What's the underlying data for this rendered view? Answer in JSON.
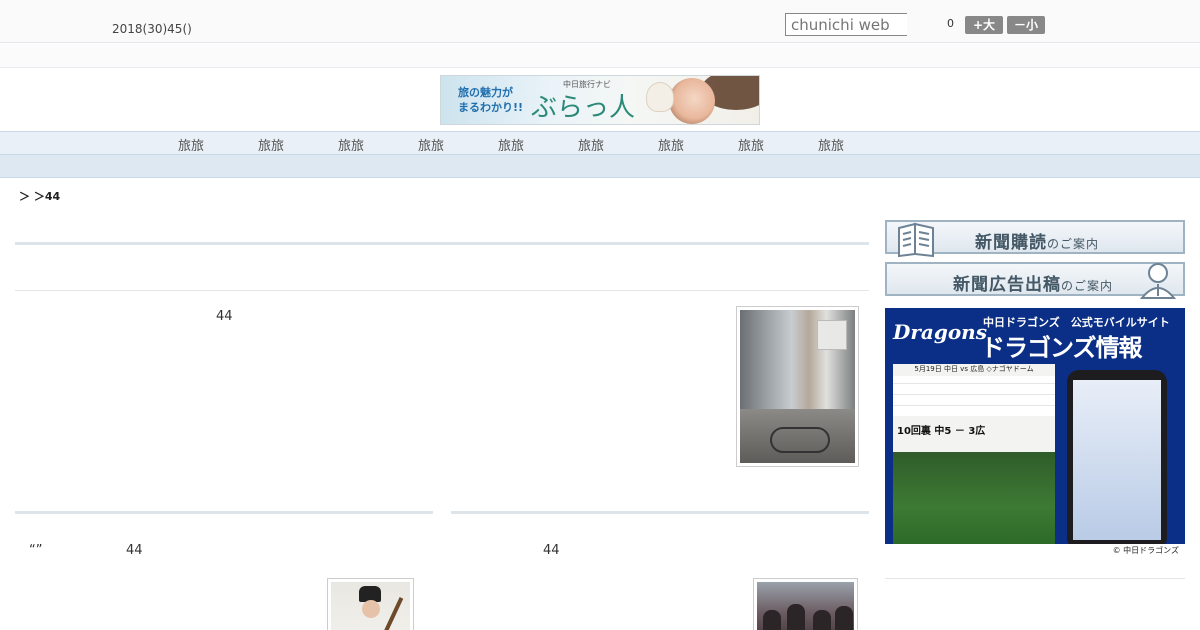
{
  "header": {
    "date": "2018(30)45()",
    "search_placeholder": "chunichi web",
    "font_size_value": "0",
    "font_bigger_label": "+大",
    "font_smaller_label": "－小"
  },
  "banner": {
    "tagline": "旅の魅力が\nまるわかり!!",
    "brand_small": "中日旅行ナビ",
    "brand": "ぶらっ人"
  },
  "nav": {
    "items": [
      "旅旅",
      "旅旅",
      "旅旅",
      "旅旅",
      "旅旅",
      "旅旅",
      "旅旅",
      "旅旅",
      "旅旅"
    ]
  },
  "breadcrumb": "＞ ＞44",
  "articles": {
    "main_number": "44",
    "left_quote": "“”",
    "left_number": "44",
    "right_number": "44"
  },
  "sidebar": {
    "subscribe_main": "新聞購読",
    "subscribe_suffix": "のご案内",
    "ad_main": "新聞広告出稿",
    "ad_suffix": "のご案内",
    "dragons": {
      "logo": "Dragons",
      "site_label": "中日ドラゴンズ　公式モバイルサイト",
      "title": "ドラゴンズ情報",
      "game_line": "5月19日 中日 vs 広島 ◇ナゴヤドーム",
      "inning": "10回裏  中5 － 3広",
      "footer": "© 中日ドラゴンズ"
    }
  }
}
